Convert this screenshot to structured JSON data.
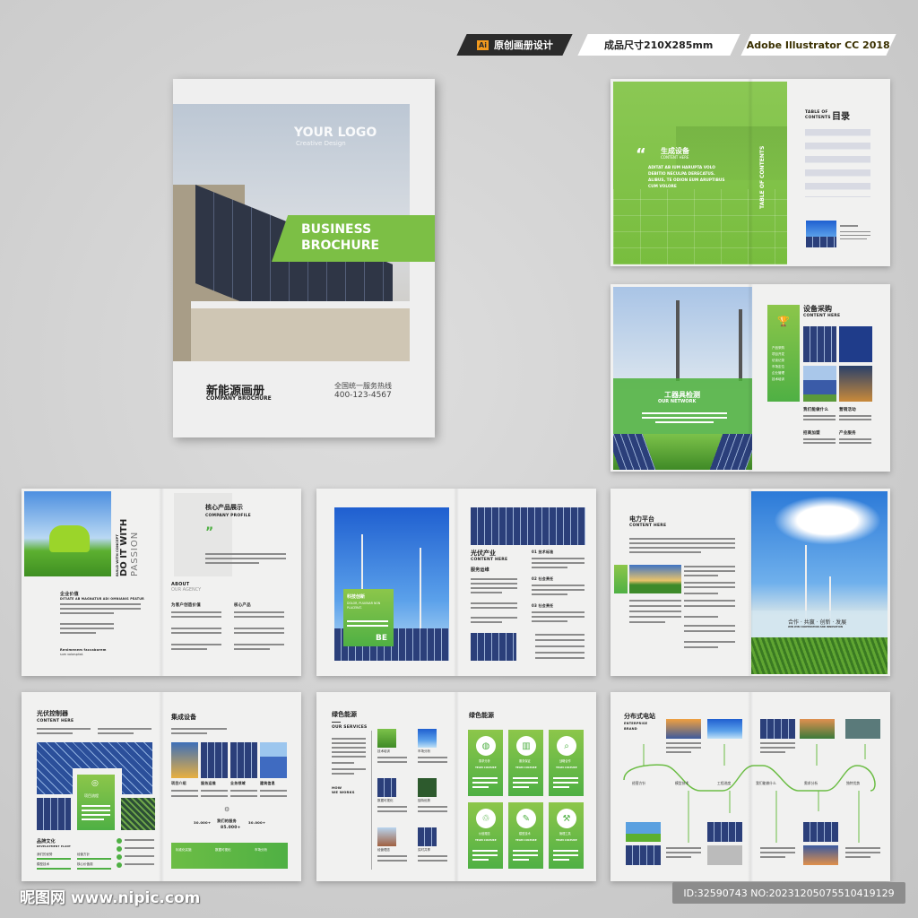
{
  "header": {
    "ai_badge": "Ai",
    "tag1": "原创画册设计",
    "tag2": "成品尺寸210X285mm",
    "tag3": "Adobe Illustrator CC 2018"
  },
  "cover": {
    "logo": "YOUR LOGO",
    "logo_sub": "Creative Design",
    "banner1": "BUSINESS",
    "banner2": "BROCHURE",
    "title_cn": "新能源画册",
    "title_en": "COMPANY BROCHURE",
    "hotline_label": "全国统一服务热线",
    "hotline": "400-123-4567"
  },
  "toc": {
    "left_title": "生成设备",
    "left_sub": "CONTENT HERE",
    "quote": "ADITAT AB IUM HARUPTA VOLO DEBITIO NECULPA DERECATUS. ALIBUS, TE ODION EUM ARUPTIBUS CUM VOLORE",
    "vertical": "TABLE OF CONTENTS",
    "toc_en1": "TABLE OF",
    "toc_en2": "CONTENTS",
    "toc_cn": "目录"
  },
  "network": {
    "title": "工器具检测",
    "sub": "OUR NETWORK",
    "right_title": "设备采购",
    "right_sub": "CONTENT HERE",
    "list": [
      "产品采购",
      "项目开发",
      "访谈记录",
      "市场定位",
      "企业管理",
      "技术培训"
    ],
    "labels": [
      "我们能做什么",
      "营销活动",
      "招商加盟",
      "产业服务"
    ]
  },
  "passion": {
    "vert1": "BUILD WITH CONCEPT",
    "vert2": "DO IT WITH",
    "vert3": "PASSION",
    "value_title": "企业价值",
    "value_sub": "DITIATE AB MAGNATUR ADI OMNIANIS PEATUR",
    "name": "Renimenem faccaborem",
    "name_sub": "sum voloruptat.",
    "right_title": "核心产品展示",
    "right_sub": "COMPANY PROFILE",
    "about1": "ABOUT",
    "about2": "OUR AGENCY",
    "col1": "为客户创造价值",
    "col2": "核心产品"
  },
  "pv": {
    "box_title": "科技创新",
    "box_sub": "DOLOR, PULVINAR NON PLACERAT.",
    "box_big": "BE",
    "title": "光伏产业",
    "sub": "CONTENT HERE",
    "service": "服务运维",
    "items": [
      "01 技术标准",
      "02 社会责任",
      "03 社会责任"
    ]
  },
  "power": {
    "title": "电力平台",
    "sub": "CONTENT HERE",
    "slogan": "合作 · 共赢 · 创新 · 发展",
    "slogan_en": "WIN WIN COOPERATION AND INNOVATION"
  },
  "controller": {
    "title": "光伏控制器",
    "sub": "CONTENT HERE",
    "box": "项目流程",
    "brand": "品牌文化",
    "brand_sub": "DEVELOPMENT PLANT",
    "bars": [
      "我们的优势",
      "经营方针",
      "模型技术",
      "核心价值观"
    ],
    "right_title": "集成设备",
    "cats": [
      "项目介绍",
      "服务运维",
      "业务领域",
      "建筑信息"
    ],
    "stat1": "30.000+",
    "stat_mid_label": "我们的服务",
    "stat_mid": "85.000+",
    "stat3": "30.000+",
    "footer": [
      "标准化实施",
      "数据可视化",
      "市场分析"
    ]
  },
  "green": {
    "title": "绿色能源",
    "sub": "OUR SERVICES",
    "how1": "HOW",
    "how2": "WE WORKS",
    "thumbs": [
      "技术培训",
      "市场分析",
      "数据可视化",
      "独特优势",
      "经营理念",
      "实时共享"
    ],
    "right_title": "绿色能源",
    "cards": [
      "需求分析",
      "服务保证",
      "战略合作",
      "价值理念",
      "模型技术",
      "管理工具"
    ],
    "card_sub": "TEAM CULTURE"
  },
  "station": {
    "title": "分布式电站",
    "sub1": "ENTERPRISE",
    "sub2": "BRAND",
    "nodes": [
      "经营方针",
      "模型技术",
      "工程进度",
      "我们能做什么",
      "需求分析",
      "独特优势"
    ]
  },
  "footer": {
    "watermark": "昵图网 www.nipic.com",
    "id": "ID:32590743 NO:20231205075510419129"
  },
  "colors": {
    "green": "#6cbd45",
    "dark": "#2b2b2b"
  }
}
